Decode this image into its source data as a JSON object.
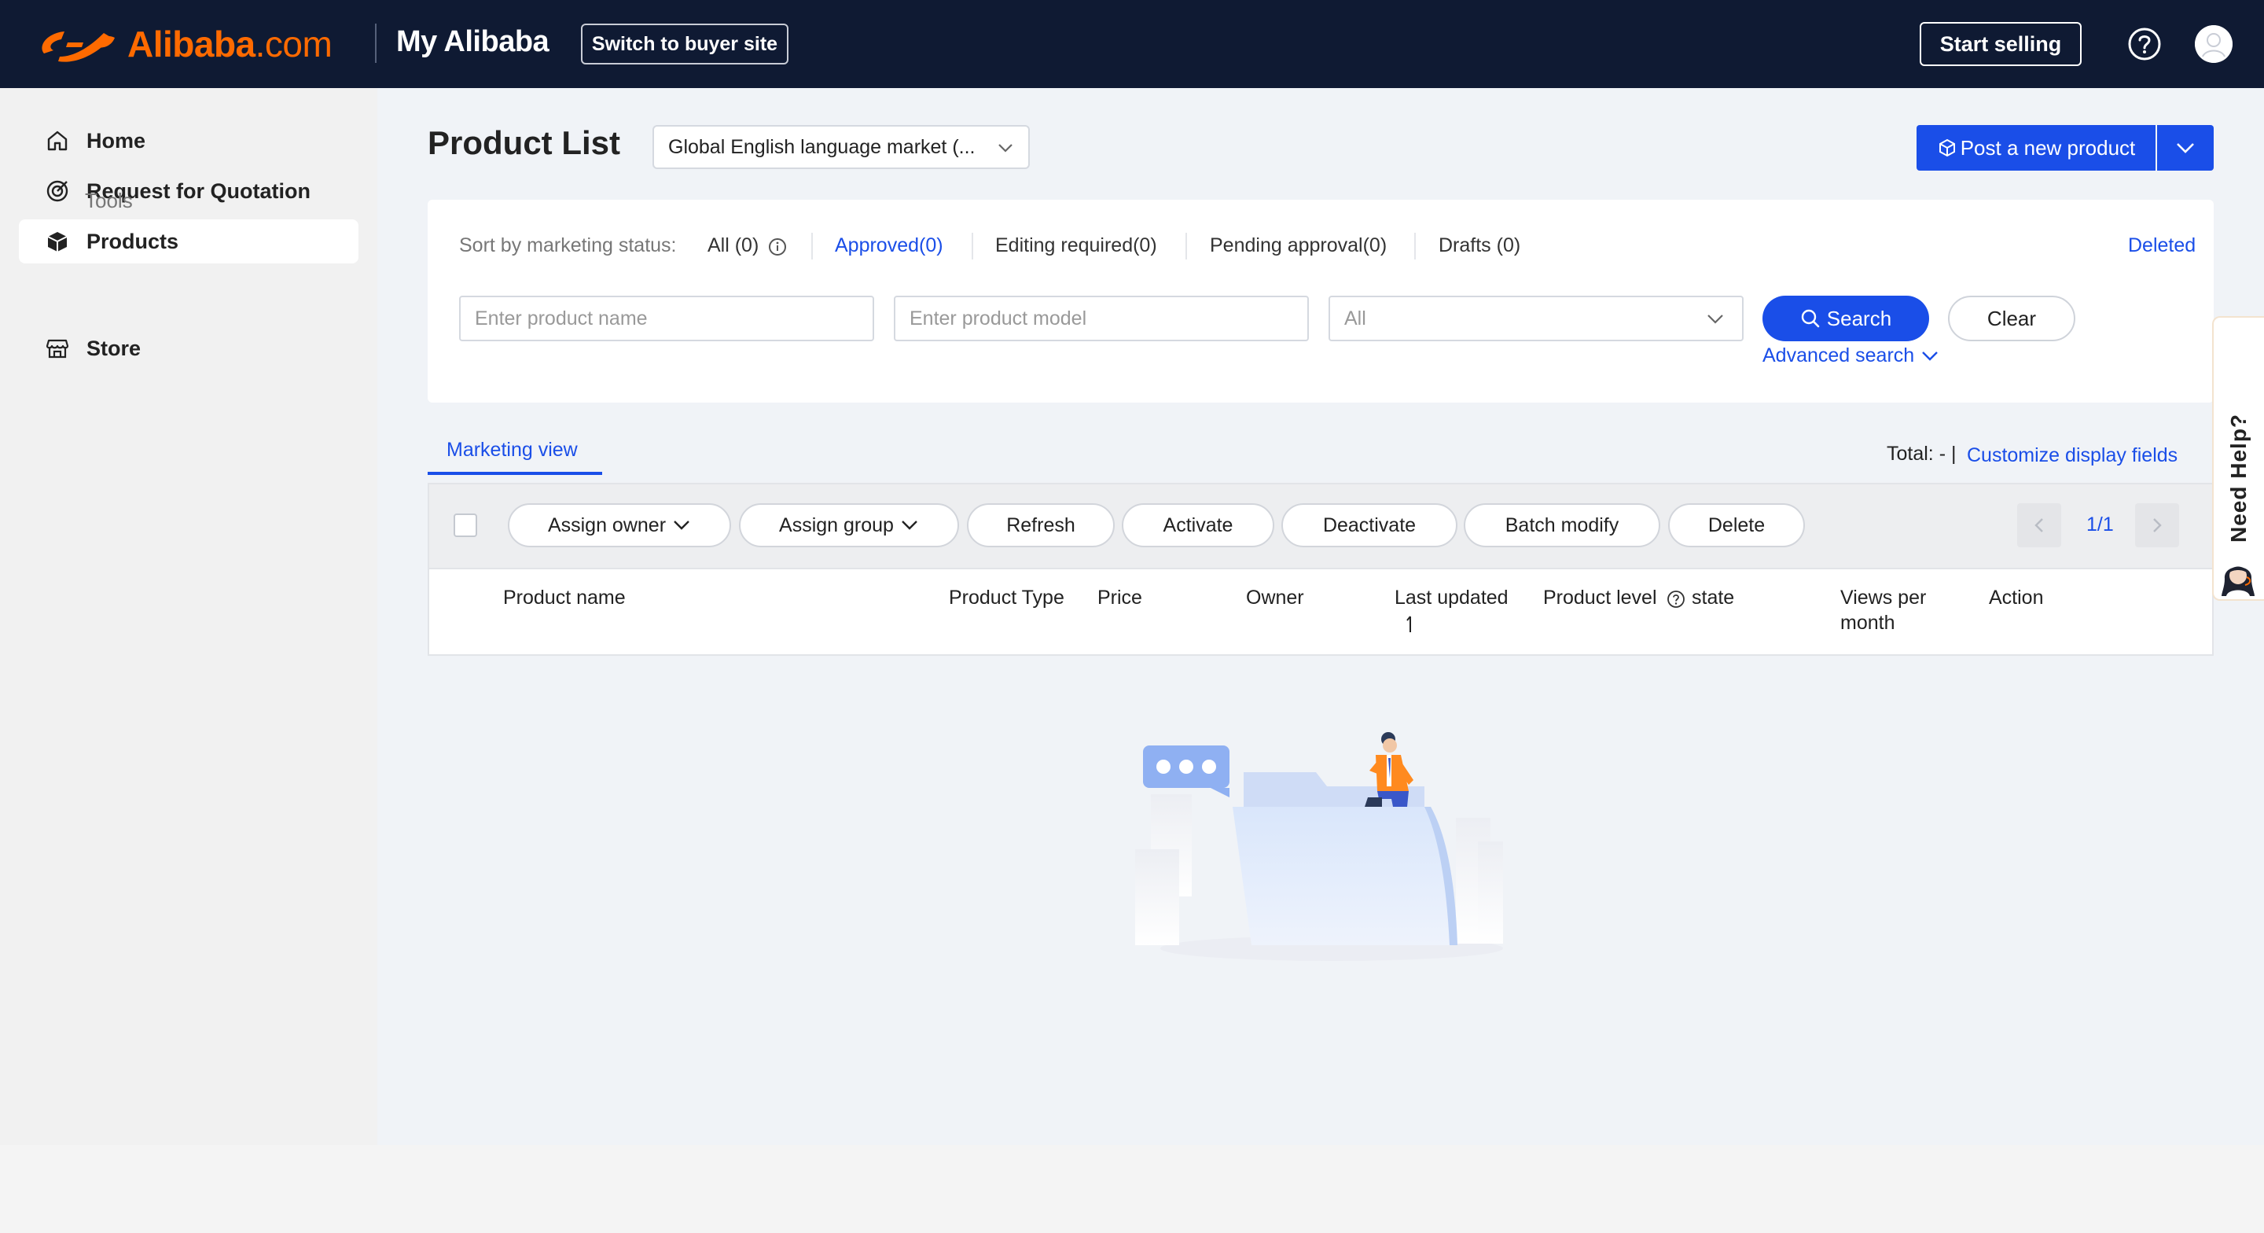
{
  "header": {
    "brand_name": "Alibaba",
    "brand_suffix": ".com",
    "title": "My Alibaba",
    "switch_label": "Switch to buyer site",
    "start_selling_label": "Start selling"
  },
  "sidebar": {
    "items": [
      {
        "label": "Home",
        "icon": "home-icon"
      },
      {
        "label": "Request for Quotation",
        "icon": "target-icon"
      },
      {
        "label": "Products",
        "icon": "cube-icon",
        "active": true
      },
      {
        "label": "Tools"
      },
      {
        "label": "Store",
        "icon": "store-icon"
      }
    ]
  },
  "page": {
    "title": "Product List",
    "market_select_value": "Global English language market  (...",
    "post_button_label": "Post a new product"
  },
  "filters": {
    "sort_label": "Sort by marketing status:",
    "status_tabs": [
      {
        "label": "All (0)"
      },
      {
        "label": "Approved(0)",
        "active": true
      },
      {
        "label": "Editing required(0)"
      },
      {
        "label": "Pending approval(0)"
      },
      {
        "label": "Drafts (0)"
      }
    ],
    "deleted_label": "Deleted",
    "product_name_placeholder": "Enter product name",
    "product_model_placeholder": "Enter product model",
    "category_select_value": "All",
    "search_label": "Search",
    "clear_label": "Clear",
    "advanced_search_label": "Advanced search"
  },
  "list": {
    "view_tab_label": "Marketing view",
    "total_label": "Total: - |",
    "customize_label": "Customize display fields",
    "actions": [
      {
        "label": "Assign owner",
        "dropdown": true
      },
      {
        "label": "Assign group",
        "dropdown": true
      },
      {
        "label": "Refresh"
      },
      {
        "label": "Activate"
      },
      {
        "label": "Deactivate"
      },
      {
        "label": "Batch modify"
      },
      {
        "label": "Delete"
      }
    ],
    "pager": "1/1",
    "columns": [
      "Product name",
      "Product Type",
      "Price",
      "Owner",
      "Last updated",
      "Product level",
      "state",
      "Views per",
      "month",
      "Action"
    ]
  },
  "help_widget": {
    "label": "Need Help?"
  },
  "colors": {
    "header_bg": "#0f1a33",
    "brand_orange": "#ff6a00",
    "primary_blue": "#1a4ee8",
    "sidebar_bg": "#f1f1f1",
    "main_bg": "#f0f3f7"
  }
}
